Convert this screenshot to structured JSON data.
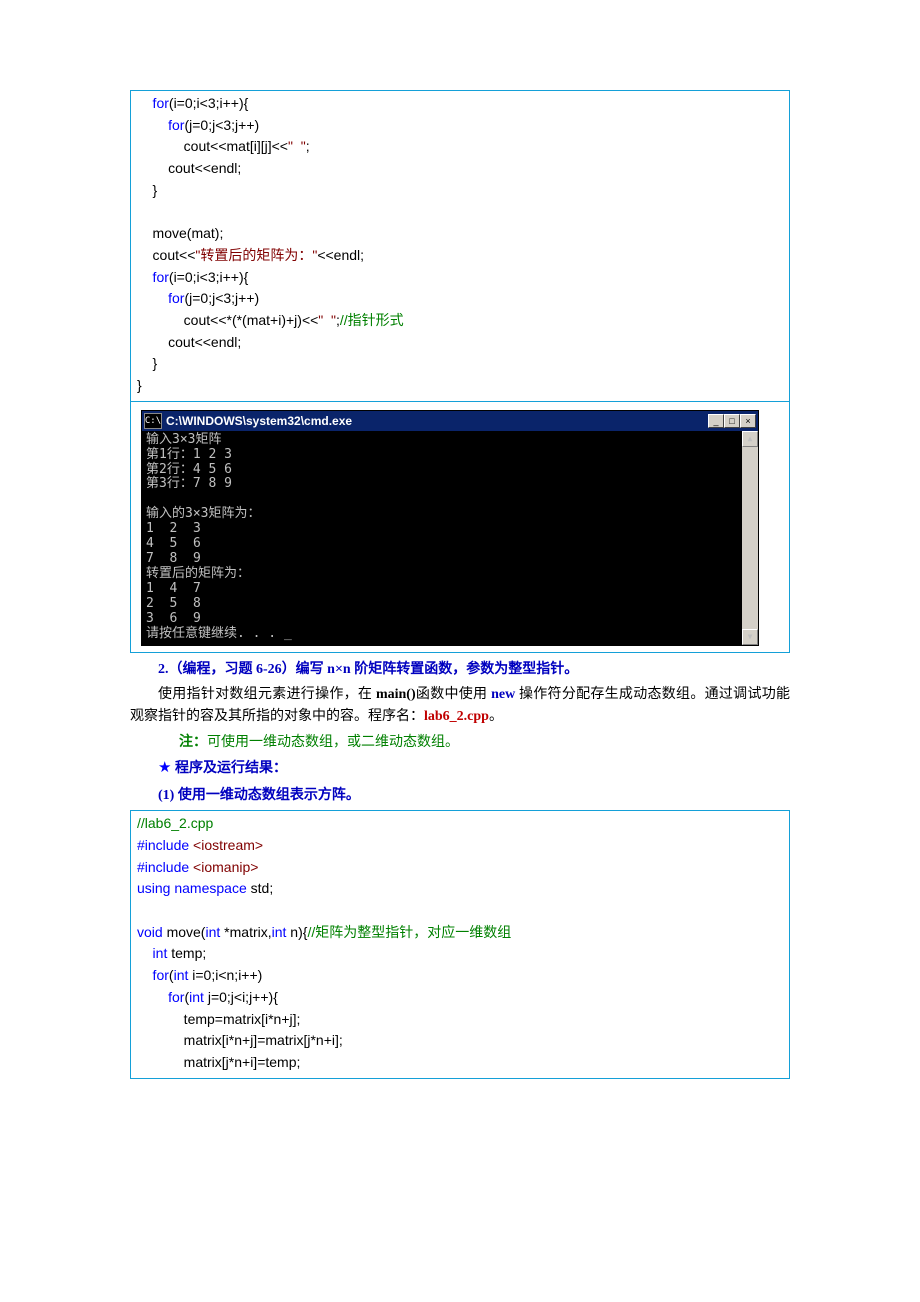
{
  "codebox1": {
    "l1a": "    for",
    "l1b": "(i=0;i<3;i++){",
    "l2a": "        for",
    "l2b": "(j=0;j<3;j++)",
    "l3a": "            cout<<mat[i][j]<<",
    "l3s": "\"  \"",
    "l3c": ";",
    "l4": "        cout<<endl;",
    "l5": "    }",
    "l6": "",
    "l7": "    move(mat);",
    "l8a": "    cout<<",
    "l8s": "\"转置后的矩阵为：\"",
    "l8c": "<<endl;",
    "l9a": "    for",
    "l9b": "(i=0;i<3;i++){",
    "l10a": "        for",
    "l10b": "(j=0;j<3;j++)",
    "l11a": "            cout<<*(*(mat+i)+j)<<",
    "l11s": "\"  \"",
    "l11c": ";",
    "l11cm": "//指针形式",
    "l12": "        cout<<endl;",
    "l13": "    }",
    "l14": "}"
  },
  "console": {
    "title_prefix": "C:\\WINDOWS\\system32\\cmd.exe",
    "icon_text": "C:\\",
    "body": "输入3×3矩阵\n第1行：1 2 3\n第2行：4 5 6\n第3行：7 8 9\n\n输入的3×3矩阵为：\n1  2  3\n4  5  6\n7  8  9\n转置后的矩阵为：\n1  4  7\n2  5  8\n3  6  9\n请按任意键继续. . . _"
  },
  "section2": {
    "heading": "2.（编程，习题 6-26）编写 n×n 阶矩阵转置函数，参数为整型指针。",
    "p1a": "使用指针对数组元素进行操作，在 ",
    "p1b": "main()",
    "p1c": "函数中使用 ",
    "p1d": "new ",
    "p1e": "操作符分配存生成动态数组。通过调试功能观察指针的容及其所指的对象中的容。程序名：",
    "p1f": "lab6_2.cpp",
    "p1g": "。",
    "note_label": "注：",
    "note_text": "可使用一维动态数组，或二维动态数组。",
    "star": "★",
    "result_heading": " 程序及运行结果：",
    "sub1": "(1) 使用一维动态数组表示方阵。"
  },
  "codebox2": {
    "l1": "//lab6_2.cpp",
    "l2a": "#include",
    "l2b": " <iostream>",
    "l3a": "#include",
    "l3b": " <iomanip>",
    "l4a": "using namespace",
    "l4b": " std;",
    "l5": "",
    "l6a": "void",
    "l6b": " move(",
    "l6c": "int",
    "l6d": " *matrix,",
    "l6e": "int",
    "l6f": " n){",
    "l6g": "//矩阵为整型指针，对应一维数组",
    "l7a": "    int",
    "l7b": " temp;",
    "l8a": "    for",
    "l8b": "(",
    "l8c": "int",
    "l8d": " i=0;i<n;i++)",
    "l9a": "        for",
    "l9b": "(",
    "l9c": "int",
    "l9d": " j=0;j<i;j++){",
    "l10": "            temp=matrix[i*n+j];",
    "l11": "            matrix[i*n+j]=matrix[j*n+i];",
    "l12": "            matrix[j*n+i]=temp;"
  }
}
